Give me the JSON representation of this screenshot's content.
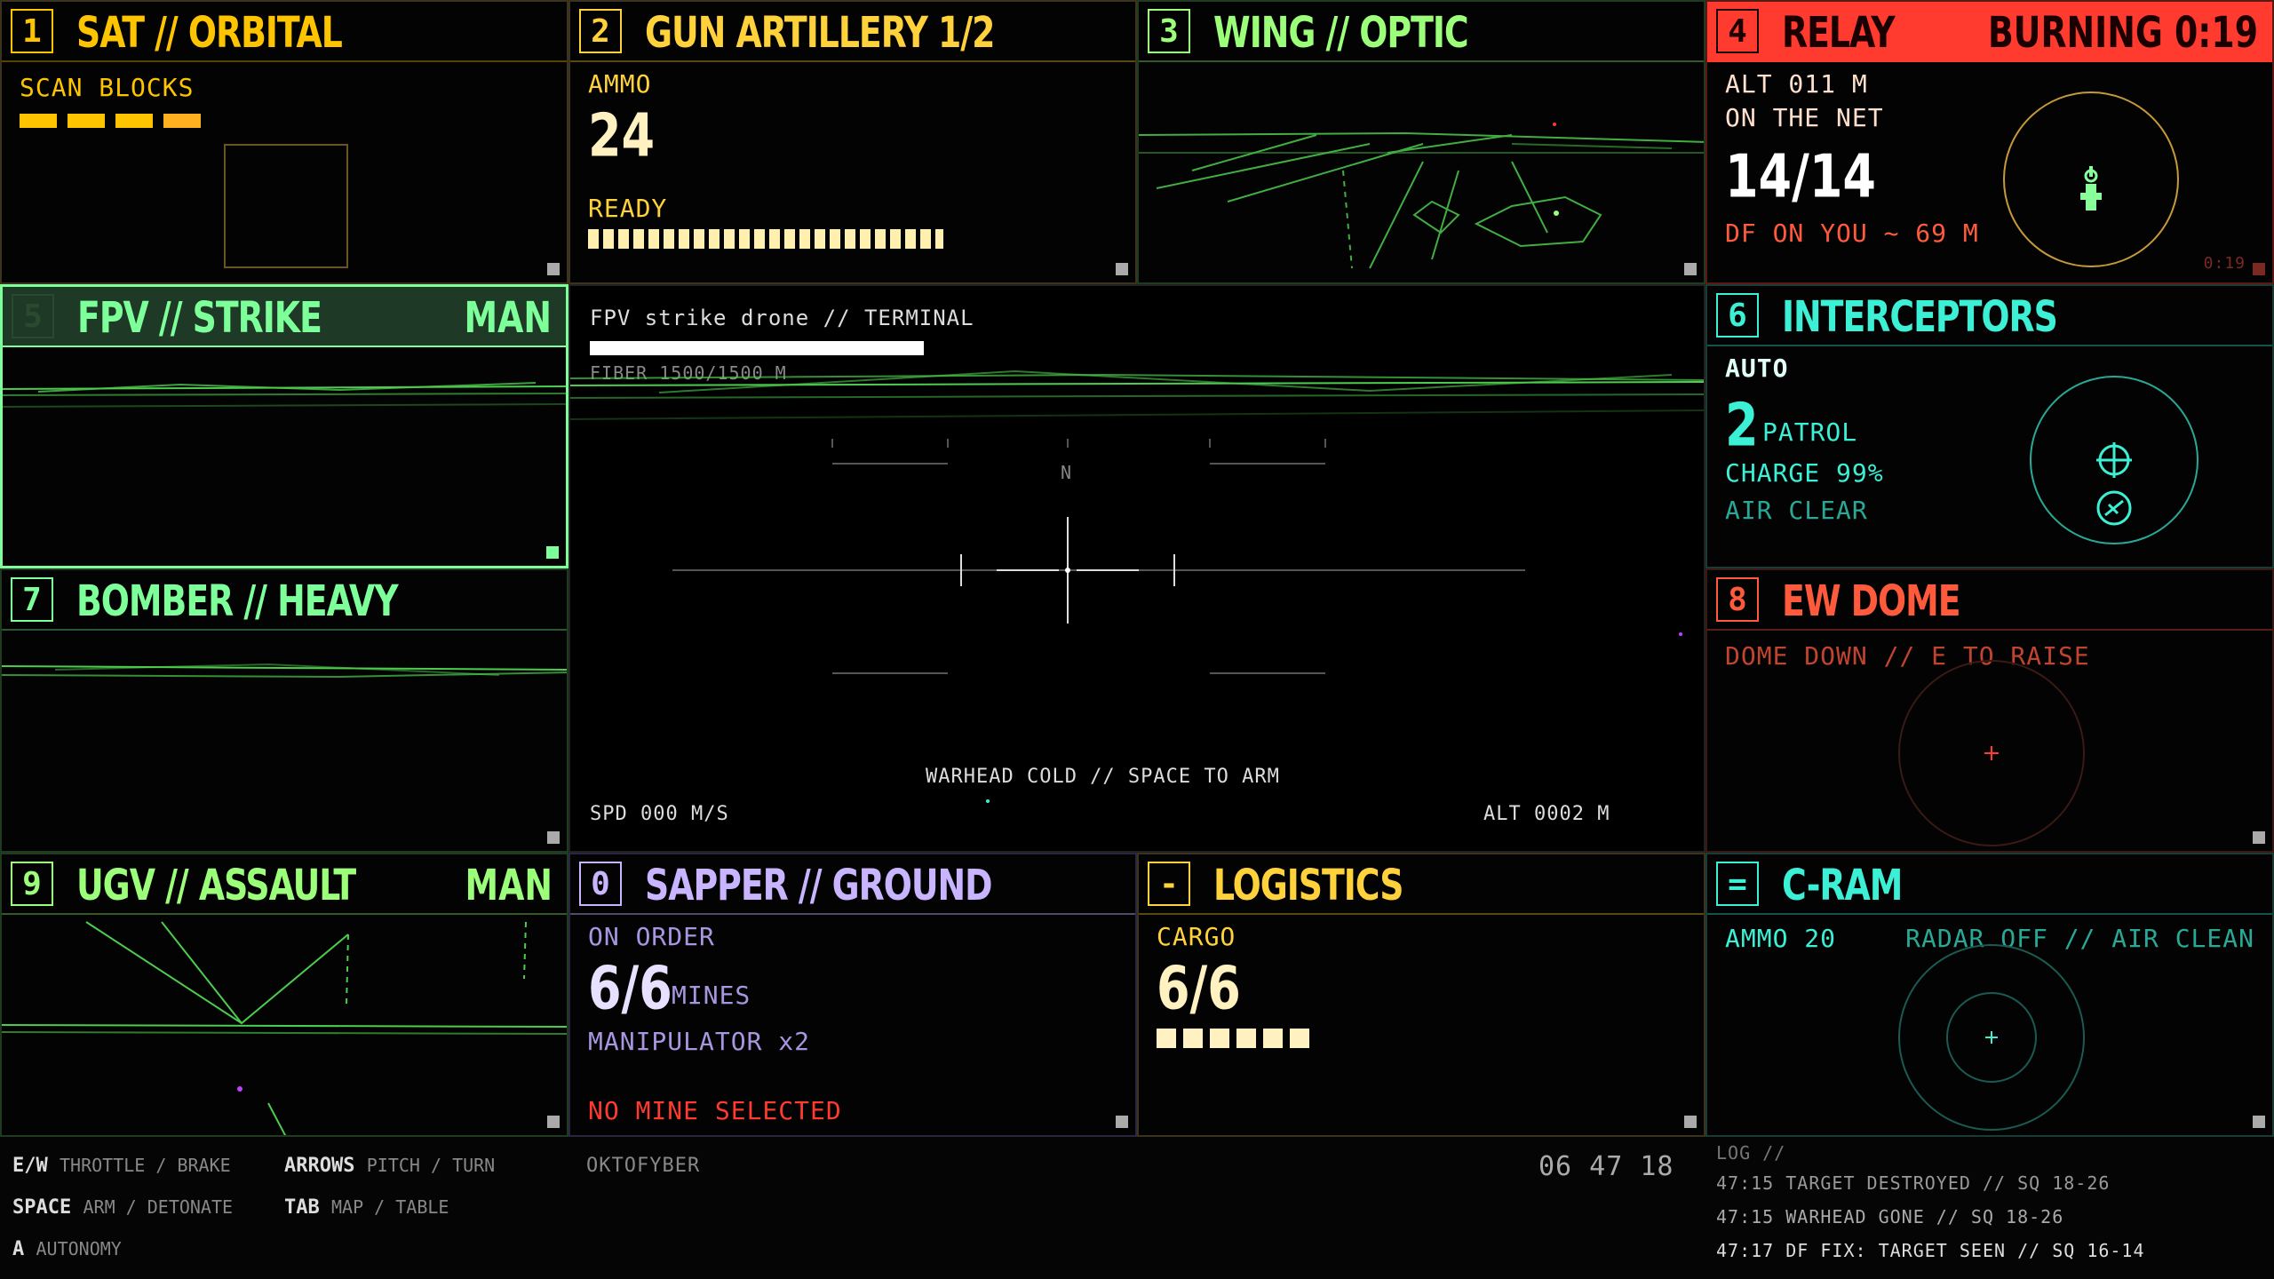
{
  "panels": {
    "p1": {
      "num": "1",
      "title": "SAT // ORBITAL",
      "label": "SCAN BLOCKS",
      "color": "#ffc400"
    },
    "p2": {
      "num": "2",
      "title": "GUN ARTILLERY 1/2",
      "ammo_label": "AMMO",
      "ammo": "24",
      "status": "READY",
      "color": "#ffd23c"
    },
    "p3": {
      "num": "3",
      "title": "WING // OPTIC",
      "color": "#9cff7a"
    },
    "p4": {
      "num": "4",
      "title": "RELAY",
      "tag": "BURNING 0:19",
      "alt": "ALT 011 M",
      "net_label": "ON THE NET",
      "net": "14/14",
      "df": "DF ON YOU ~ 69 M",
      "timer": "0:19",
      "color": "#ff3a2e"
    },
    "p5": {
      "num": "5",
      "title": "FPV // STRIKE",
      "tag": "MAN",
      "color": "#7dff9a"
    },
    "p6": {
      "num": "6",
      "title": "INTERCEPTORS",
      "mode": "AUTO",
      "count": "2",
      "count_label": "PATROL",
      "charge": "CHARGE 99%",
      "air": "AIR CLEAR",
      "color": "#3cf0d6"
    },
    "p7": {
      "num": "7",
      "title": "BOMBER // HEAVY",
      "color": "#7dff9a"
    },
    "p8": {
      "num": "8",
      "title": "EW DOME",
      "status": "DOME DOWN // E TO RAISE",
      "color": "#ff5a3c"
    },
    "p9": {
      "num": "9",
      "title": "UGV // ASSAULT",
      "tag": "MAN",
      "color": "#9cff7a"
    },
    "p0": {
      "num": "0",
      "title": "SAPPER // GROUND",
      "order": "ON ORDER",
      "mines": "6/6",
      "mines_label": "MINES",
      "manip": "MANIPULATOR x2",
      "warn": "NO MINE SELECTED",
      "color": "#c8b4ff"
    },
    "pm": {
      "num": "-",
      "title": "LOGISTICS",
      "cargo_label": "CARGO",
      "cargo": "6/6",
      "color": "#ffd23c"
    },
    "pe": {
      "num": "=",
      "title": "C-RAM",
      "ammo": "AMMO 20",
      "radar": "RADAR OFF // AIR CLEAN",
      "color": "#3cf0d6"
    }
  },
  "main": {
    "title": "FPV strike drone // TERMINAL",
    "fiber": "FIBER 1500/1500 M",
    "heading": "N",
    "warhead": "WARHEAD COLD // SPACE TO ARM",
    "speed": "SPD 000 M/S",
    "alt": "ALT 0002 M"
  },
  "footer": {
    "keys": [
      {
        "k": "E/W",
        "d": "THROTTLE / BRAKE"
      },
      {
        "k": "SPACE",
        "d": "ARM / DETONATE"
      },
      {
        "k": "A",
        "d": "AUTONOMY"
      },
      {
        "k": "ARROWS",
        "d": "PITCH / TURN"
      },
      {
        "k": "TAB",
        "d": "MAP / TABLE"
      }
    ],
    "callsign": "OKTOFYBER",
    "clock": "06 47 18",
    "log_title": "LOG //",
    "log": [
      "47:15 TARGET DESTROYED // SQ 18-26",
      "47:15 WARHEAD GONE // SQ 18-26",
      "47:17 DF FIX: TARGET SEEN // SQ 16-14"
    ]
  }
}
